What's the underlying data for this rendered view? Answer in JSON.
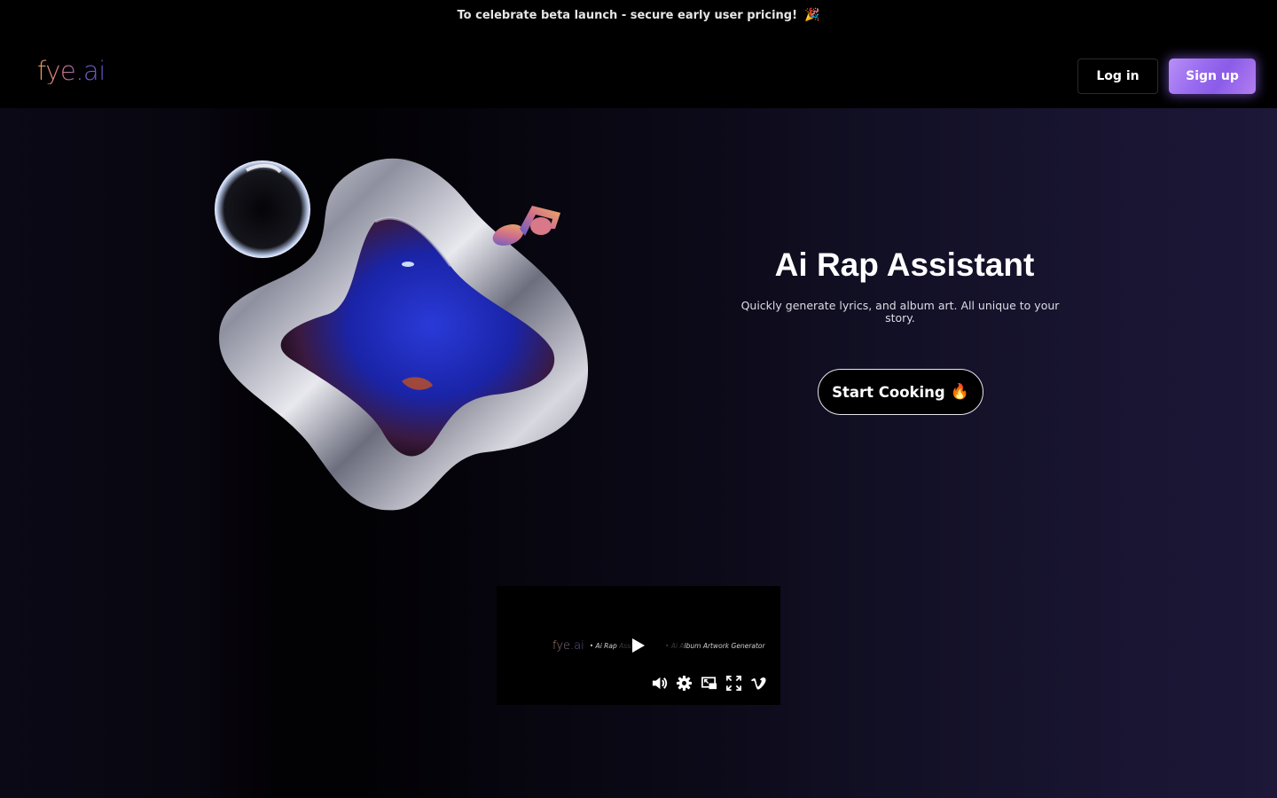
{
  "announcement": {
    "text": "To celebrate beta launch - secure early user pricing!",
    "emoji": "🎉"
  },
  "header": {
    "logo": "fye.ai",
    "login_label": "Log in",
    "signup_label": "Sign up"
  },
  "hero": {
    "title": "Ai Rap Assistant",
    "subtitle": "Quickly generate lyrics, and album art. All unique to your story.",
    "cta_label": "Start Cooking",
    "cta_emoji": "🔥",
    "art_description": "Chrome liquid frame with blue-lit portrait, glass bubble and gradient music note"
  },
  "video": {
    "logo": "fye.ai",
    "caption_part1": "• Ai Rap ",
    "caption_part1_dim": "Assist",
    "caption_part2_dim": "• Ai A",
    "caption_part2": "lbum Artwork Generator",
    "controls": [
      "volume-icon",
      "settings-icon",
      "picture-in-picture-icon",
      "fullscreen-icon",
      "vimeo-icon"
    ]
  },
  "colors": {
    "signup_accent": "#9a6cf0",
    "hero_bg_right": "#1d1738",
    "hero_bg_left": "#0b0916"
  }
}
